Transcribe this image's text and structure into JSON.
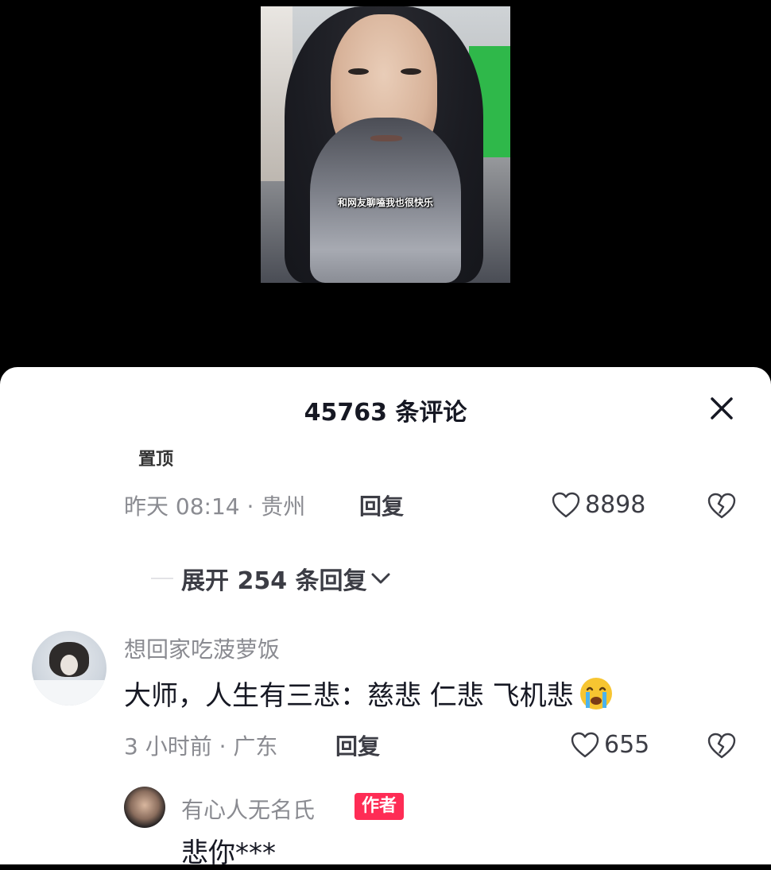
{
  "video": {
    "subtitle": "和网友聊嗑我也很快乐"
  },
  "comments_panel": {
    "title": "45763 条评论",
    "pinned_label": "置顶",
    "pinned_comment": {
      "meta": "昨天 08:14 · 贵州",
      "reply_label": "回复",
      "likes": "8898"
    },
    "expand_replies": "展开 254 条回复",
    "comment": {
      "username": "想回家吃菠萝饭",
      "text": "大师，人生有三悲：慈悲 仁悲  飞机悲",
      "emoji": "loudly-crying-face",
      "meta": "3 小时前 · 广东",
      "reply_label": "回复",
      "likes": "655"
    },
    "author_reply": {
      "username": "有心人无名氏",
      "badge": "作者",
      "text": "悲你***"
    }
  },
  "colors": {
    "sheet_bg": "#ffffff",
    "author_badge": "#fe2c55",
    "meta_gray": "#8a8b91"
  }
}
